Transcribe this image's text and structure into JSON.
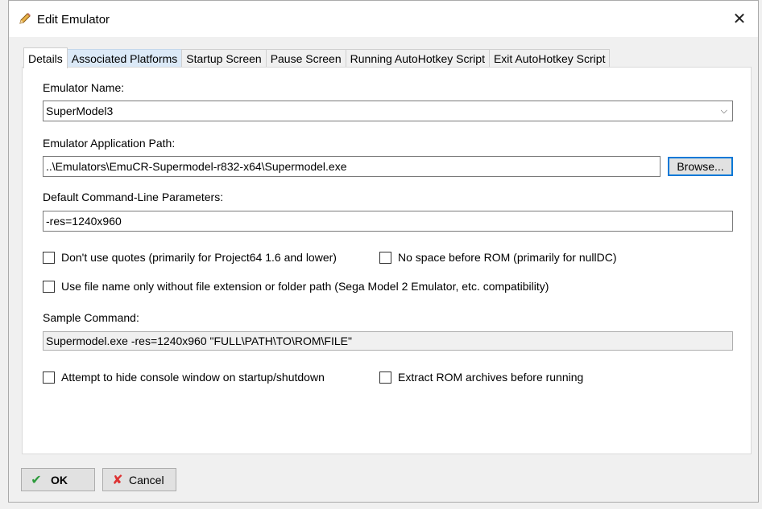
{
  "window": {
    "title": "Edit Emulator",
    "close_symbol": "✕"
  },
  "tabs": [
    {
      "label": "Details"
    },
    {
      "label": "Associated Platforms"
    },
    {
      "label": "Startup Screen"
    },
    {
      "label": "Pause Screen"
    },
    {
      "label": "Running AutoHotkey Script"
    },
    {
      "label": "Exit AutoHotkey Script"
    }
  ],
  "details": {
    "emulator_name_label": "Emulator Name:",
    "emulator_name_value": "SuperModel3",
    "app_path_label": "Emulator Application Path:",
    "app_path_value": "..\\Emulators\\EmuCR-Supermodel-r832-x64\\Supermodel.exe",
    "browse_label": "Browse...",
    "params_label": "Default Command-Line Parameters:",
    "params_value": "-res=1240x960",
    "cb_no_quotes": "Don't use quotes (primarily for Project64 1.6 and lower)",
    "cb_no_space": "No space before ROM (primarily for nullDC)",
    "cb_filename_only": "Use file name only without file extension or folder path (Sega Model 2 Emulator, etc. compatibility)",
    "sample_label": "Sample Command:",
    "sample_value": "Supermodel.exe -res=1240x960 \"FULL\\PATH\\TO\\ROM\\FILE\"",
    "cb_hide_console": "Attempt to hide console window on startup/shutdown",
    "cb_extract": "Extract ROM archives before running"
  },
  "footer": {
    "ok_label": "OK",
    "cancel_label": "Cancel"
  },
  "colors": {
    "accent": "#0078d7",
    "ok_icon": "#2e9b3d",
    "cancel_icon": "#dd3333"
  }
}
